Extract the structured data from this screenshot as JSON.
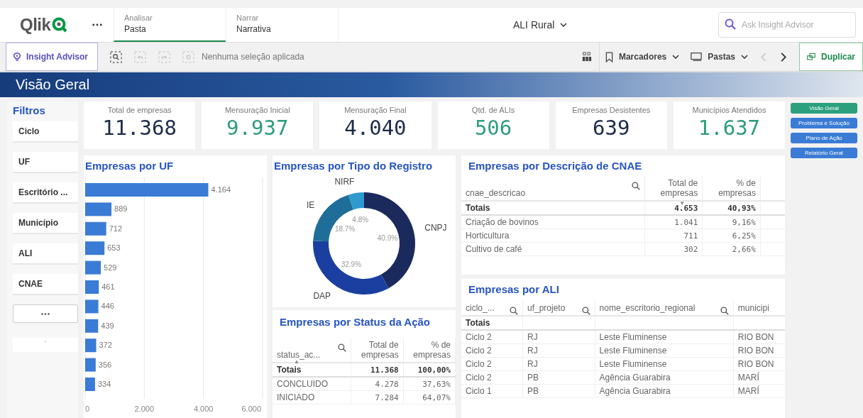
{
  "header": {
    "logo": "Qlik",
    "tabs": [
      {
        "label": "Analisar",
        "sub": "Pasta",
        "selected": true
      },
      {
        "label": "Narrar",
        "sub": "Narrativa",
        "selected": false
      }
    ],
    "app_title": "ALI Rural",
    "search": {
      "placeholder": "Ask Insight Advisor"
    }
  },
  "toolbar": {
    "insight_button": "Insight Advisor",
    "tools": [
      {
        "kind": "smart-search",
        "disabled": false
      },
      {
        "kind": "back",
        "disabled": true
      },
      {
        "kind": "forward",
        "disabled": true
      },
      {
        "kind": "clear",
        "disabled": true
      }
    ],
    "selection_status": "Nenhuma seleção aplicada",
    "bookmarks": "Marcadores",
    "sheets": "Pastas",
    "nav": [
      {
        "kind": "prev",
        "disabled": true
      },
      {
        "kind": "next",
        "disabled": false
      }
    ],
    "duplicate": "Duplicar"
  },
  "sheet_title": "Visão Geral",
  "filters": {
    "title": "Filtros",
    "items": [
      "Ciclo",
      "UF",
      "Escritório ...",
      "Município",
      "ALI",
      "CNAE"
    ],
    "footer": "-"
  },
  "kpis": [
    {
      "label": "Total de empresas",
      "value": "11.368",
      "color": "#1d2b4a"
    },
    {
      "label": "Mensuração Inicial",
      "value": "9.937",
      "color": "#2e9b7e"
    },
    {
      "label": "Mensuração Final",
      "value": "4.040",
      "color": "#1d2b4a"
    },
    {
      "label": "Qtd. de ALIs",
      "value": "506",
      "color": "#2e9b7e"
    },
    {
      "label": "Empresas Desistentes",
      "value": "639",
      "color": "#1d2b4a"
    },
    {
      "label": "Municípios Atendidos",
      "value": "1.637",
      "color": "#2e9b7e"
    }
  ],
  "uf_chart": {
    "title": "Empresas por UF",
    "chart_data": {
      "type": "bar",
      "orientation": "horizontal",
      "values": [
        4164,
        889,
        712,
        653,
        529,
        461,
        446,
        439,
        372,
        356,
        334
      ],
      "xlim": [
        0,
        6000
      ],
      "xticks": [
        {
          "value": 0,
          "label": "0"
        },
        {
          "value": 2000,
          "label": "2.000"
        },
        {
          "value": 4000,
          "label": "4.000"
        },
        {
          "value": 6000,
          "label": "6.000"
        }
      ],
      "value_labels": [
        "4.164",
        "889",
        "712",
        "653",
        "529",
        "461",
        "446",
        "439",
        "372",
        "356",
        "334"
      ]
    }
  },
  "registro_chart": {
    "title": "Empresas por Tipo do Registro",
    "chart_data": {
      "type": "donut",
      "categories": [
        "CNPJ",
        "DAP",
        "IE",
        "NIRF"
      ],
      "values": [
        40.9,
        32.9,
        18.7,
        4.8
      ],
      "value_labels": [
        "40.9%",
        "32.9%",
        "18.7%",
        "4.8%"
      ]
    }
  },
  "status_table": {
    "title": "Empresas por Status da Ação",
    "columns": [
      {
        "label": "status_ac...",
        "search": true,
        "sort_mark": "▲"
      },
      {
        "label": "Total de empresas",
        "search": false
      },
      {
        "label": "% de empresas",
        "search": false
      }
    ],
    "totals": [
      "Totais",
      "11.368",
      "100,00%"
    ],
    "rows": [
      [
        "CONCLUIDO",
        "4.278",
        "37,63%"
      ],
      [
        "INICIADO",
        "7.284",
        "64,07%"
      ]
    ]
  },
  "cnae_table": {
    "title": "Empresas por Descrição de CNAE",
    "columns": [
      {
        "label": "cnae_descricao",
        "search": true
      },
      {
        "label": "Total de empresas",
        "search": false,
        "sort_mark": "▼"
      },
      {
        "label": "% de empresas",
        "search": false
      }
    ],
    "totals": [
      "Totais",
      "4.653",
      "40,93%"
    ],
    "rows": [
      [
        "Criação de bovinos",
        "1.041",
        "9,16%"
      ],
      [
        "Horticultura",
        "711",
        "6,25%"
      ],
      [
        "Cultivo de café",
        "302",
        "2,66%"
      ]
    ]
  },
  "ali_table": {
    "title": "Empresas por ALI",
    "columns": [
      {
        "label": "ciclo_...",
        "search": true
      },
      {
        "label": "uf_projeto",
        "search": true
      },
      {
        "label": "nome_escritorio_regional",
        "search": true
      },
      {
        "label": "municipi",
        "search": false
      }
    ],
    "totals": "Totais",
    "rows": [
      [
        "Ciclo 2",
        "RJ",
        "Leste Fluminense",
        "RIO BON"
      ],
      [
        "Ciclo 2",
        "RJ",
        "Leste Fluminense",
        "RIO BON"
      ],
      [
        "Ciclo 2",
        "RJ",
        "Leste Fluminense",
        "RIO BON"
      ],
      [
        "Ciclo 2",
        "PB",
        "Agência Guarabira",
        "MARÍ"
      ],
      [
        "Ciclo 1",
        "PB",
        "Agência Guarabira",
        "MARÍ"
      ]
    ]
  },
  "sheet_nav": [
    {
      "label": "Visão Geral",
      "selected": true
    },
    {
      "label": "Problema e Solução",
      "selected": false
    },
    {
      "label": "Plano de Ação",
      "selected": false
    },
    {
      "label": "Relatório Geral",
      "selected": false
    }
  ]
}
